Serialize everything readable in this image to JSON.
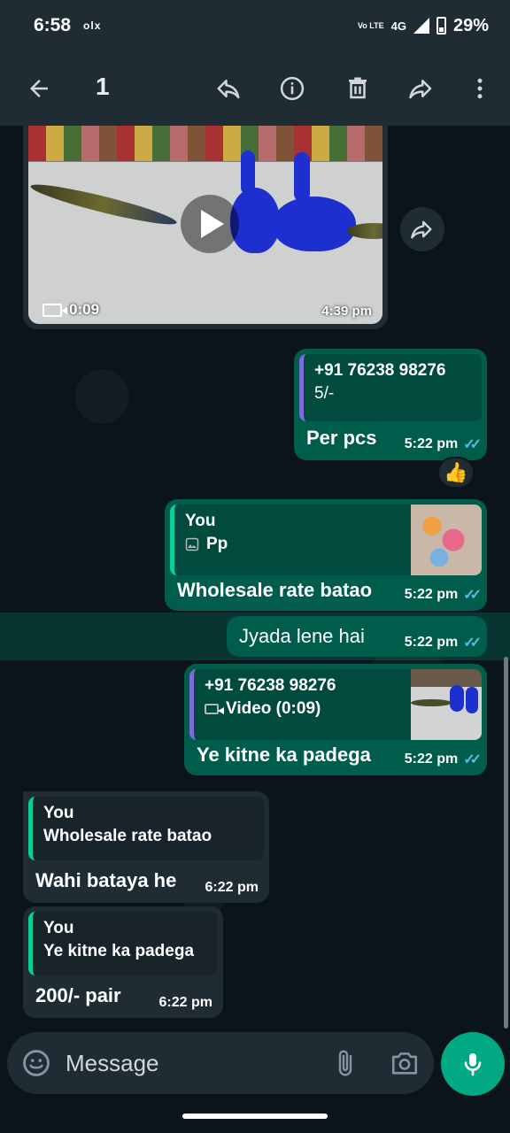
{
  "status_bar": {
    "time": "6:58",
    "app_badge": "olx",
    "volte": "Vo LTE",
    "network": "4G",
    "battery": "29%"
  },
  "app_bar": {
    "selected_count": "1"
  },
  "messages": {
    "video": {
      "duration": "0:09",
      "time": "4:39 pm"
    },
    "m1": {
      "quote_name": "+91 76238 98276",
      "quote_text": "5/-",
      "text": "Per pcs",
      "time": "5:22 pm",
      "reaction": "👍"
    },
    "m2": {
      "quote_name": "You",
      "quote_text": "Pp",
      "text": "Wholesale rate batao",
      "time": "5:22 pm"
    },
    "m3": {
      "text": "Jyada lene hai",
      "time": "5:22 pm"
    },
    "m4": {
      "quote_name": "+91 76238 98276",
      "quote_text": "Video (0:09)",
      "text": "Ye kitne ka padega",
      "time": "5:22 pm"
    },
    "m5": {
      "quote_name": "You",
      "quote_text": "Wholesale rate batao",
      "text": "Wahi bataya he",
      "time": "6:22 pm"
    },
    "m6": {
      "quote_name": "You",
      "quote_text": "Ye kitne ka padega",
      "text": "200/- pair",
      "time": "6:22 pm"
    }
  },
  "composer": {
    "placeholder": "Message"
  },
  "colors": {
    "incoming": "#1f2c34",
    "outgoing": "#005c4b",
    "accent": "#00a884",
    "read_ticks": "#53bdeb"
  }
}
